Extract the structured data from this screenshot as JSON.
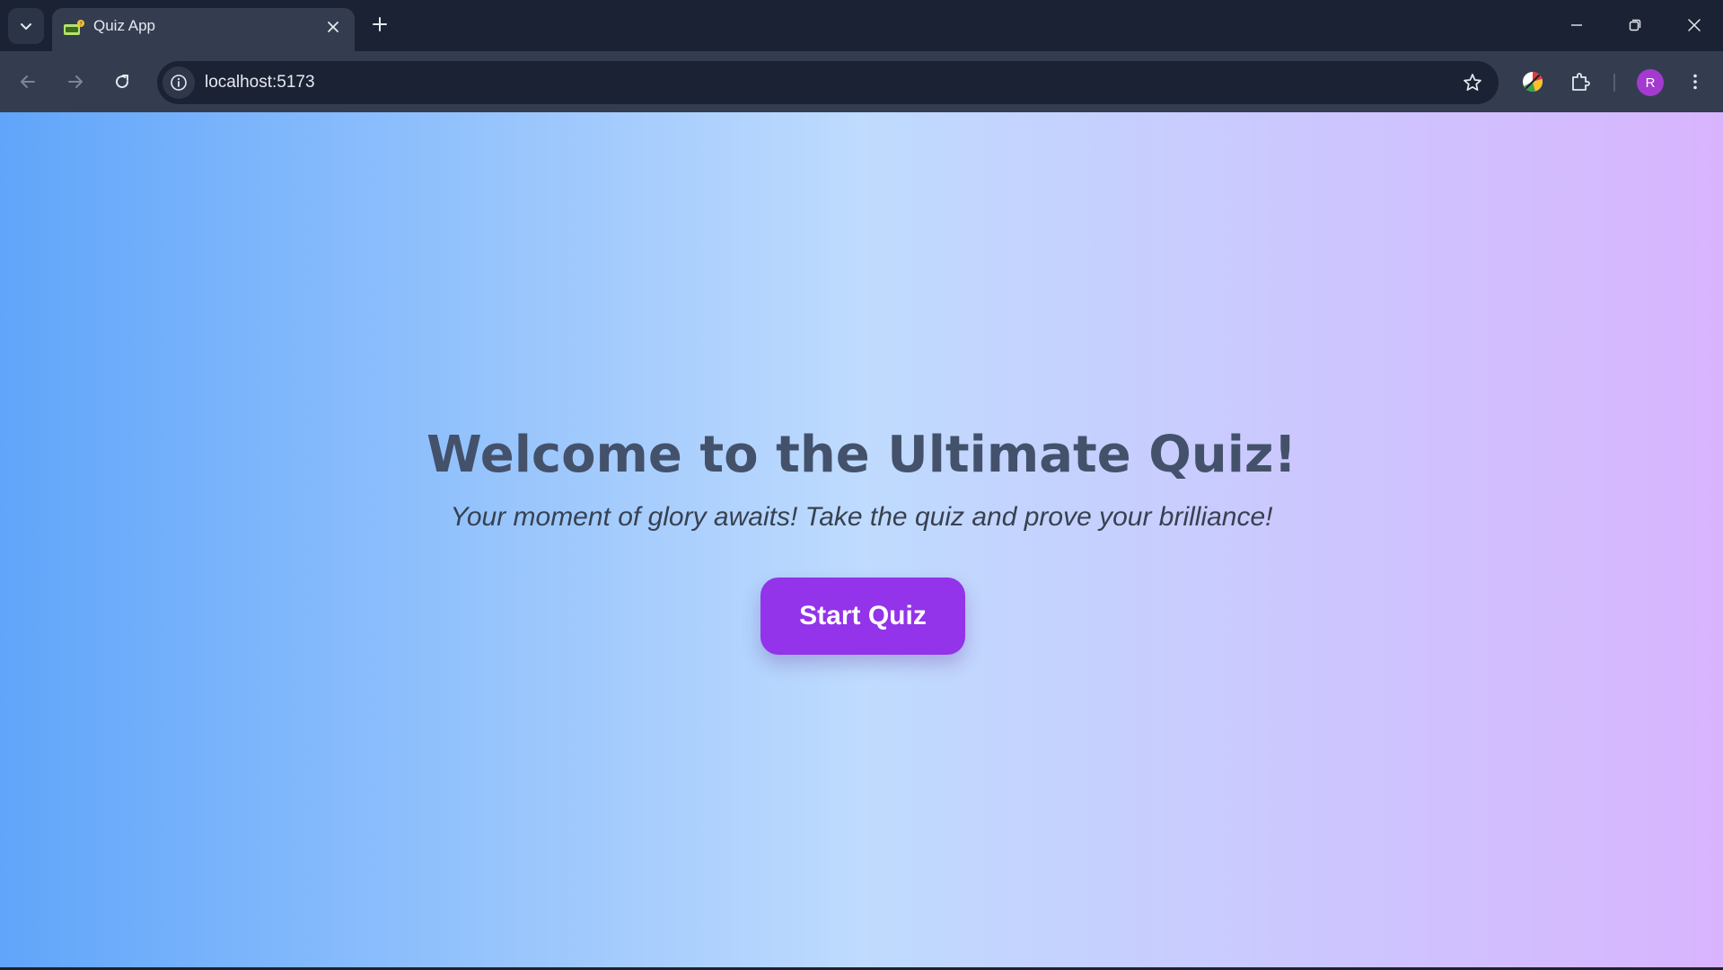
{
  "browser": {
    "tab": {
      "title": "Quiz App",
      "favicon": "quiz-favicon-icon"
    },
    "address_bar": {
      "url": "localhost:5173"
    },
    "profile": {
      "initial": "R",
      "color": "#a43ad0"
    }
  },
  "page": {
    "title": "Welcome to the Ultimate Quiz!",
    "subtitle": "Your moment of glory awaits! Take the quiz and prove your brilliance!",
    "start_button_label": "Start Quiz",
    "colors": {
      "gradient_start": "#60a5fa",
      "gradient_middle": "#bfdbfe",
      "gradient_end": "#d8b4fe",
      "button": "#9333ea",
      "title_text": "#44516b"
    }
  }
}
